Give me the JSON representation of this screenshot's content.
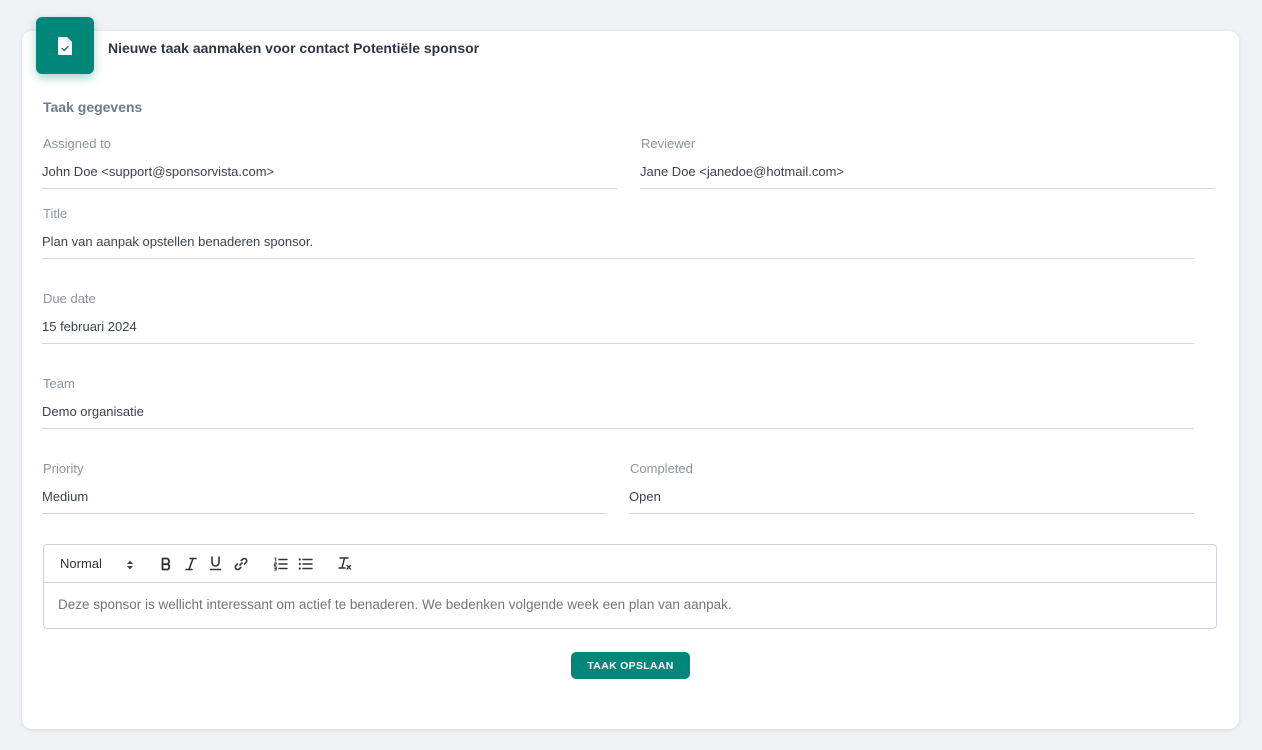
{
  "header": {
    "title": "Nieuwe taak aanmaken voor contact Potentiële sponsor",
    "icon": "document-check-icon",
    "accent_color": "#00877a"
  },
  "form": {
    "section_title": "Taak gegevens",
    "assigned_to": {
      "label": "Assigned to",
      "value": "John Doe <support@sponsorvista.com>"
    },
    "reviewer": {
      "label": "Reviewer",
      "value": "Jane Doe <janedoe@hotmail.com>"
    },
    "title": {
      "label": "Title",
      "value": "Plan van aanpak opstellen benaderen sponsor."
    },
    "due_date": {
      "label": "Due date",
      "value": "15 februari 2024"
    },
    "team": {
      "label": "Team",
      "value": "Demo organisatie"
    },
    "priority": {
      "label": "Priority",
      "value": "Medium"
    },
    "completed": {
      "label": "Completed",
      "value": "Open"
    }
  },
  "editor": {
    "format_select": "Normal",
    "toolbar_icons": [
      "bold-icon",
      "italic-icon",
      "underline-icon",
      "link-icon",
      "ordered-list-icon",
      "bullet-list-icon",
      "clear-format-icon"
    ],
    "content": "Deze sponsor is wellicht interessant om actief te benaderen. We bedenken volgende week een plan van aanpak."
  },
  "actions": {
    "save_label": "TAAK OPSLAAN"
  }
}
